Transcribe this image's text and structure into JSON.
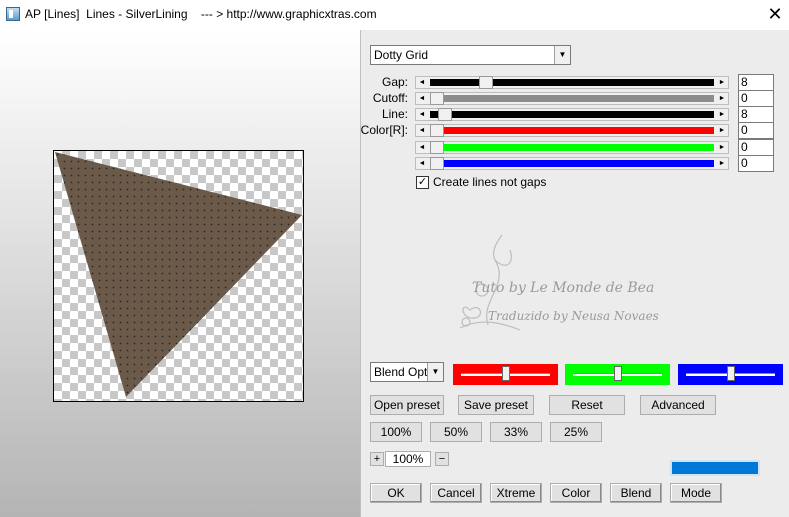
{
  "window": {
    "title": "AP [Lines]  Lines - SilverLining    --- > http://www.graphicxtras.com",
    "close_glyph": "✕"
  },
  "effect_select": {
    "value": "Dotty Grid"
  },
  "sliders": [
    {
      "label": "Gap:",
      "value": "8",
      "fill": "#000000",
      "level": 0.18
    },
    {
      "label": "Cutoff:",
      "value": "0",
      "fill": "#8c8c8c",
      "level": 0.0
    },
    {
      "label": "Line:",
      "value": "8",
      "fill": "#000000",
      "level": 0.03
    },
    {
      "label": "Color[R]:",
      "value": "0",
      "fill": "#ff0000",
      "level": 0.0
    },
    {
      "label": "",
      "value": "0",
      "fill": "#00ff00",
      "level": 0.0
    },
    {
      "label": "",
      "value": "0",
      "fill": "#0000ff",
      "level": 0.0
    }
  ],
  "checkbox": {
    "label": "Create lines not gaps",
    "checked": true,
    "mark": "✓"
  },
  "watermark": {
    "line1": "Tuto by Le Monde de Bea",
    "line2": "Traduzido by Neusa Novaes"
  },
  "blend_select": {
    "value": "Blend Optio"
  },
  "color_sliders": [
    {
      "color": "#ff0000",
      "level": 0.5
    },
    {
      "color": "#00ff00",
      "level": 0.5
    },
    {
      "color": "#0000ff",
      "level": 0.5
    }
  ],
  "buttons": {
    "open_preset": "Open preset",
    "save_preset": "Save preset",
    "reset": "Reset",
    "advanced": "Advanced",
    "z100": "100%",
    "z50": "50%",
    "z33": "33%",
    "z25": "25%",
    "ok": "OK",
    "cancel": "Cancel",
    "xtreme": "Xtreme",
    "color": "Color",
    "blend": "Blend",
    "mode": "Mode"
  },
  "zoom": {
    "value": "100%",
    "plus": "+",
    "minus": "−"
  },
  "output_color": "#0078d7",
  "preview_fill": "#6b5a4a"
}
